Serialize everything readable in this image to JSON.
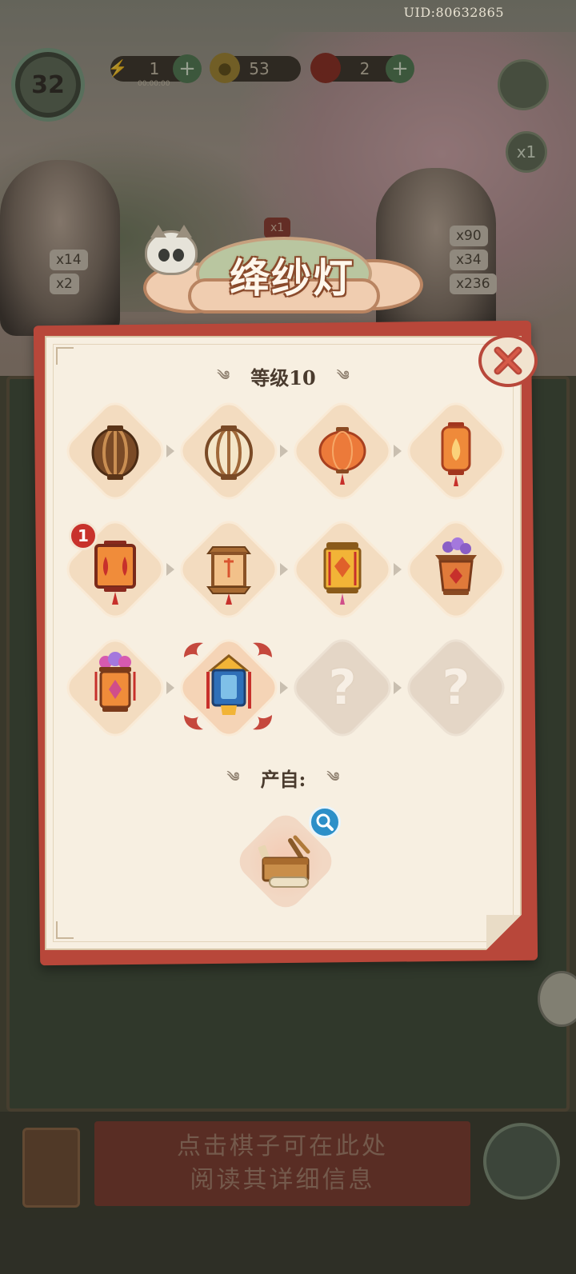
{
  "uid": "UID:80632865",
  "hud": {
    "player_level": "32",
    "energy": {
      "value": "1",
      "sub": "00:00:00"
    },
    "coins": {
      "value": "53"
    },
    "gems": {
      "value": "2"
    },
    "boost": "x1"
  },
  "bg_chips": {
    "left": [
      "x14",
      "x2"
    ],
    "right": [
      "x90",
      "x34",
      "x236"
    ],
    "center": "x1"
  },
  "modal": {
    "title": "绛纱灯",
    "level_label": "等级10",
    "produced_from_label": "产自:",
    "items": [
      {
        "name": "lantern-frame-dark",
        "state": "unlocked",
        "count": ""
      },
      {
        "name": "lantern-frame-light",
        "state": "unlocked",
        "count": ""
      },
      {
        "name": "round-red-lantern",
        "state": "unlocked",
        "count": ""
      },
      {
        "name": "flame-lantern",
        "state": "unlocked",
        "count": ""
      },
      {
        "name": "square-palace-lantern",
        "state": "unlocked",
        "count": "1"
      },
      {
        "name": "hexagon-lantern",
        "state": "unlocked",
        "count": ""
      },
      {
        "name": "golden-lantern",
        "state": "unlocked",
        "count": ""
      },
      {
        "name": "flower-vase-lantern",
        "state": "unlocked",
        "count": ""
      },
      {
        "name": "flower-hanging-lantern",
        "state": "unlocked",
        "count": ""
      },
      {
        "name": "blue-crowned-lantern",
        "state": "current",
        "count": ""
      },
      {
        "name": "unknown",
        "state": "locked",
        "count": "",
        "glyph": "?"
      },
      {
        "name": "unknown",
        "state": "locked",
        "count": "",
        "glyph": "?"
      }
    ]
  },
  "bottom": {
    "hint_line1": "点击棋子可在此处",
    "hint_line2": "阅读其详细信息"
  },
  "colors": {
    "card_red": "#b8473a",
    "card_paper": "#f7efe1",
    "tile_peach": "#f3dcc0",
    "badge_red": "#c8322c",
    "search_blue": "#2c8fc8"
  }
}
